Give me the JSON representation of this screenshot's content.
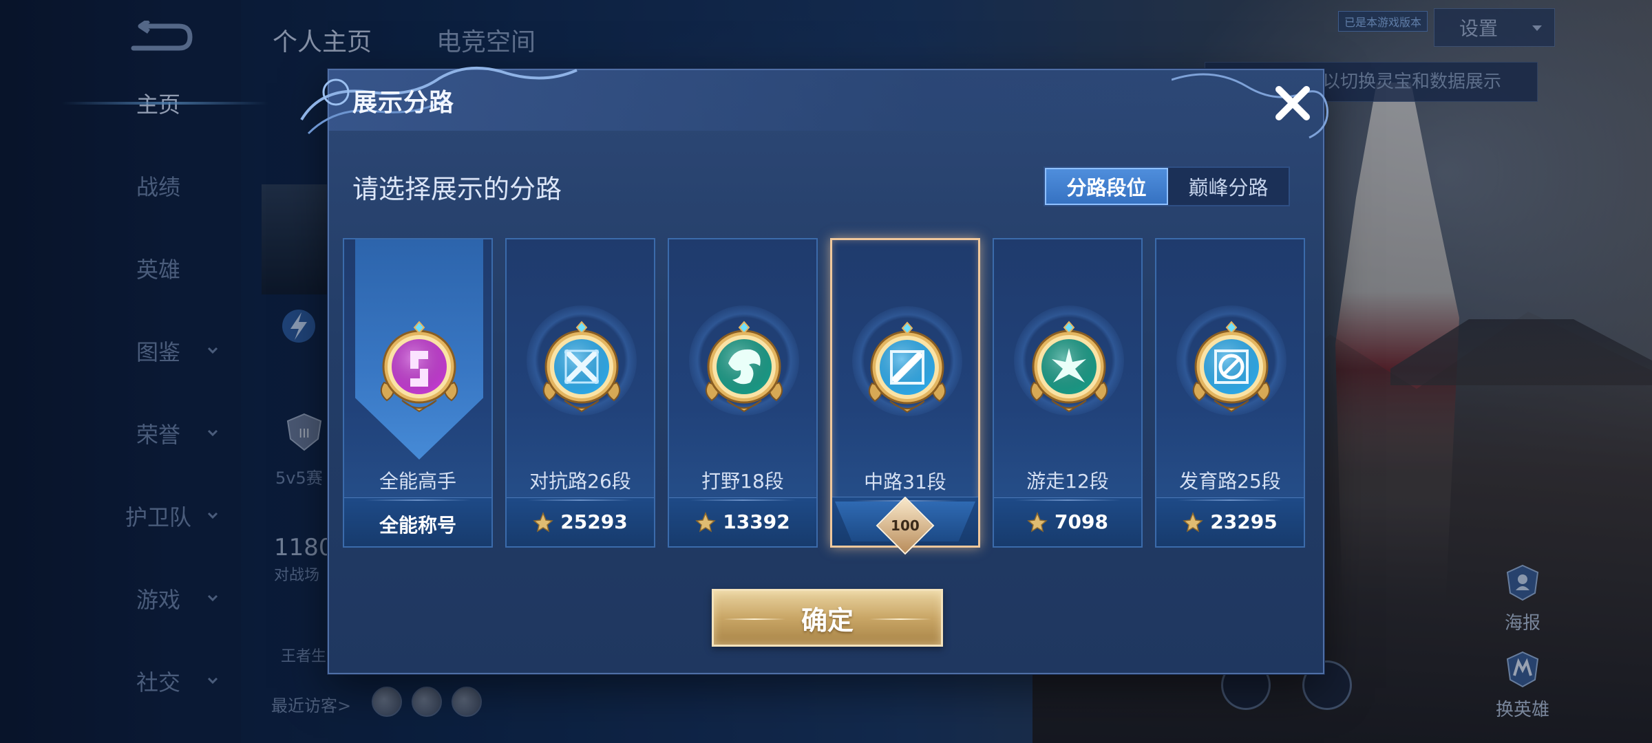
{
  "sidebar": {
    "items": [
      {
        "label": "主页",
        "active": true,
        "has_chevron": false
      },
      {
        "label": "战绩",
        "active": false,
        "has_chevron": false
      },
      {
        "label": "英雄",
        "active": false,
        "has_chevron": false
      },
      {
        "label": "图鉴",
        "active": false,
        "has_chevron": true
      },
      {
        "label": "荣誉",
        "active": false,
        "has_chevron": true
      },
      {
        "label": "护卫队",
        "active": false,
        "has_chevron": true
      },
      {
        "label": "游戏",
        "active": false,
        "has_chevron": true
      },
      {
        "label": "社交",
        "active": false,
        "has_chevron": true
      }
    ]
  },
  "top_tabs": {
    "home": "个人主页",
    "esports": "电竞空间"
  },
  "top_right": {
    "version_badge": "已是本游戏版本",
    "settings_label": "设置",
    "hint_text": "以切换灵宝和数据展示"
  },
  "background": {
    "mode_5v5": "5v5赛",
    "score": "1180",
    "score_label": "对战场",
    "king_label": "王者生",
    "recent_visitors": "最近访客>",
    "poster_label": "海报",
    "swap_hero_label": "换英雄"
  },
  "dialog": {
    "title": "展示分路",
    "prompt": "请选择展示的分路",
    "toggle": {
      "options": [
        "分路段位",
        "巅峰分路"
      ],
      "selected_index": 0
    },
    "cards": [
      {
        "name": "全能高手",
        "points": "全能称号",
        "emblem": "all-round-emblem-icon",
        "color": "#c23bd0",
        "selected": false
      },
      {
        "name": "对抗路26段",
        "points": "25293",
        "emblem": "clash-lane-emblem-icon",
        "color": "#2ea9e8",
        "selected": false
      },
      {
        "name": "打野18段",
        "points": "13392",
        "emblem": "jungle-emblem-icon",
        "color": "#1a9a86",
        "selected": false
      },
      {
        "name": "中路31段",
        "points": "100",
        "emblem": "mid-lane-emblem-icon",
        "color": "#2ea9e8",
        "selected": true
      },
      {
        "name": "游走12段",
        "points": "7098",
        "emblem": "roam-emblem-icon",
        "color": "#1a9a86",
        "selected": false
      },
      {
        "name": "发育路25段",
        "points": "23295",
        "emblem": "farm-lane-emblem-icon",
        "color": "#2ea9e8",
        "selected": false
      }
    ],
    "confirm_label": "确定"
  },
  "colors": {
    "accent_gold": "#d8b77a",
    "toggle_active": "#4080d0",
    "selected_border": "#f0c89c"
  }
}
